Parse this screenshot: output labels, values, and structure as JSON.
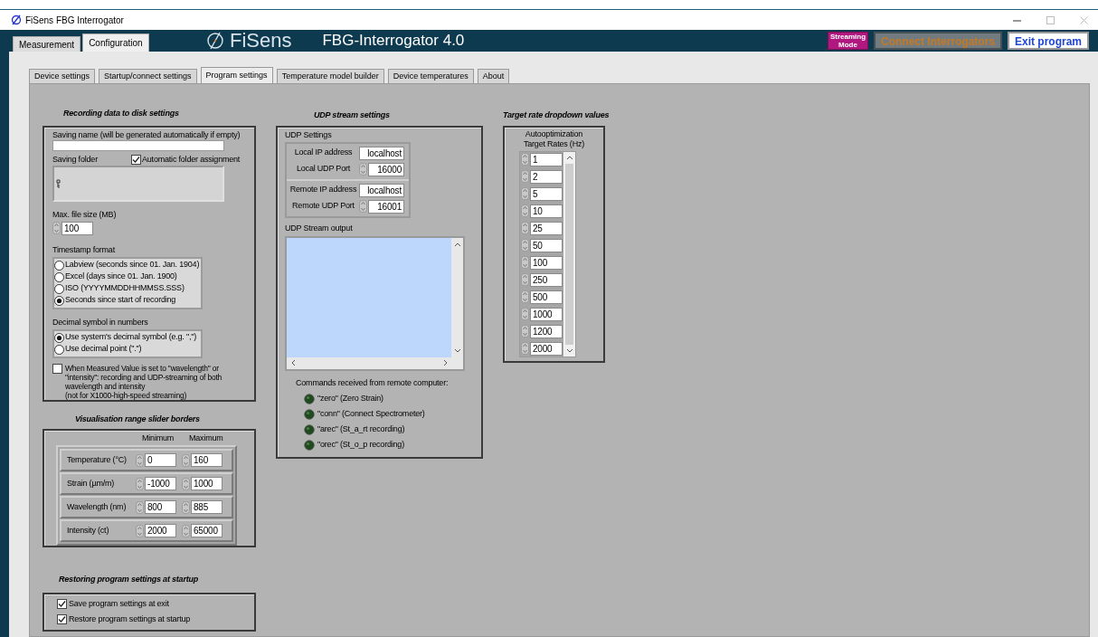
{
  "window": {
    "title": "FiSens FBG Interrogator"
  },
  "main_tabs": [
    {
      "label": "Measurement",
      "selected": false
    },
    {
      "label": "Configuration",
      "selected": true
    }
  ],
  "header": {
    "logo": "FiSens",
    "title": "FBG-Interrogator 4.0"
  },
  "header_buttons": [
    {
      "kind": "mode",
      "label": "Streaming\nMode",
      "disabled": false
    },
    {
      "kind": "connect",
      "label": "Connect Interrogators",
      "disabled": true
    },
    {
      "kind": "exit",
      "label": "Exit program",
      "disabled": false
    }
  ],
  "sub_tabs": [
    {
      "label": "Device settings",
      "selected": false
    },
    {
      "label": "Startup/connect settings",
      "selected": false
    },
    {
      "label": "Program settings",
      "selected": true
    },
    {
      "label": "Temperature model builder",
      "selected": false
    },
    {
      "label": "Device temperatures",
      "selected": false
    },
    {
      "label": "About",
      "selected": false
    }
  ],
  "recording": {
    "title": "Recording data to disk settings",
    "saving_name_label": "Saving name (will be generated automatically if empty)",
    "saving_folder_label": "Saving folder",
    "auto_folder": {
      "label": "Automatic folder assignment",
      "checked": true
    },
    "max_file_size_label": "Max. file size (MB)",
    "max_file_size": "100",
    "timestamp_label": "Timestamp format",
    "timestamp_options": [
      {
        "label": "Labview (seconds since 01. Jan. 1904)",
        "selected": false
      },
      {
        "label": "Excel (days since 01. Jan. 1900)",
        "selected": false
      },
      {
        "label": "ISO (YYYYMMDDHHMMSS.SSS)",
        "selected": false
      },
      {
        "label": "Seconds since start of recording",
        "selected": true
      }
    ],
    "decimal_label": "Decimal symbol in numbers",
    "decimal_options": [
      {
        "label": "Use system's decimal symbol (e.g. \",\")",
        "selected": true
      },
      {
        "label": "Use decimal point (\".\")",
        "selected": false
      }
    ],
    "both_values": {
      "label": "When Measured Value is set to \"wavelength\" or\n\"intensity\": recording and UDP-streaming of both\nwavelength and intensity\n(not for X1000-high-speed streaming)",
      "checked": false
    }
  },
  "visualisation": {
    "title": "Visualisation range slider borders",
    "columns": [
      "Minimum",
      "Maximum"
    ],
    "rows": [
      {
        "label": "Temperature (°C)",
        "min": "0",
        "max": "160"
      },
      {
        "label": "Strain (µm/m)",
        "min": "-1000",
        "max": "1000"
      },
      {
        "label": "Wavelength (nm)",
        "min": "800",
        "max": "885"
      },
      {
        "label": "Intensity (ct)",
        "min": "2000",
        "max": "65000"
      }
    ]
  },
  "restoring": {
    "title": "Restoring program settings at startup",
    "options": [
      {
        "label": "Save program settings at exit",
        "checked": true
      },
      {
        "label": "Restore program settings at startup",
        "checked": true
      }
    ]
  },
  "udp": {
    "title": "UDP stream settings",
    "settings_label": "UDP Settings",
    "groups": [
      [
        {
          "label": "Local IP address",
          "value": "localhost",
          "kind": "text"
        },
        {
          "label": "Local UDP Port",
          "value": "16000",
          "kind": "numeric"
        }
      ],
      [
        {
          "label": "Remote IP address",
          "value": "localhost",
          "kind": "text"
        },
        {
          "label": "Remote UDP Port",
          "value": "16001",
          "kind": "numeric"
        }
      ]
    ],
    "output_label": "UDP Stream output",
    "commands_label": "Commands received from remote computer:",
    "commands": [
      {
        "label": "\"zero\" (Zero Strain)",
        "on": false
      },
      {
        "label": "\"conn\" (Connect Spectrometer)",
        "on": false
      },
      {
        "label": "\"arec\" (St_a_rt recording)",
        "on": false
      },
      {
        "label": "\"orec\" (St_o_p recording)",
        "on": false
      }
    ]
  },
  "target_rates": {
    "title": "Target rate dropdown values",
    "label": "Autooptimization\nTarget Rates (Hz)",
    "values": [
      "1",
      "2",
      "5",
      "10",
      "25",
      "50",
      "100",
      "250",
      "500",
      "1000",
      "1200",
      "2000"
    ]
  }
}
